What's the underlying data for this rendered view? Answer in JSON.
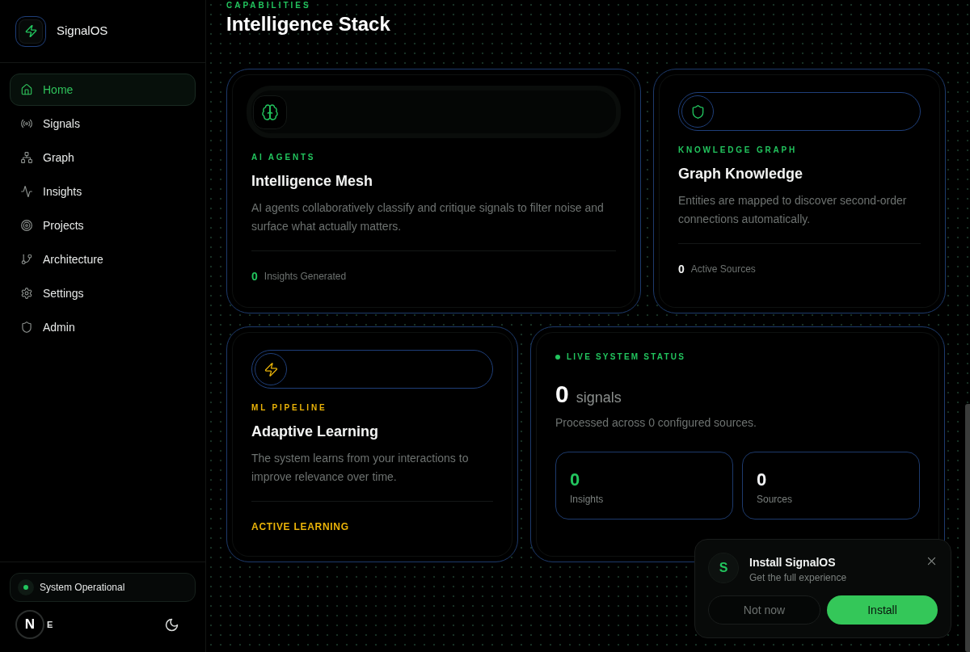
{
  "sidebar": {
    "brand": "SignalOS",
    "nav": [
      {
        "label": "Home",
        "selected": true
      },
      {
        "label": "Signals",
        "selected": false
      },
      {
        "label": "Graph",
        "selected": false
      },
      {
        "label": "Insights",
        "selected": false
      },
      {
        "label": "Projects",
        "selected": false
      },
      {
        "label": "Architecture",
        "selected": false
      },
      {
        "label": "Settings",
        "selected": false
      },
      {
        "label": "Admin",
        "selected": false
      }
    ],
    "status": "System Operational",
    "avatar_letter": "N",
    "user_label": "E"
  },
  "header": {
    "eyebrow": "CAPABILITIES",
    "title": "Intelligence Stack"
  },
  "cards": [
    {
      "kind": "agents",
      "color": "#22c55e",
      "tag": "AI AGENTS",
      "title": "Intelligence Mesh",
      "description": "AI agents collaboratively classify and critique signals to filter noise and surface what actually matters.",
      "stat_value": "0",
      "stat_label": "Insights Generated"
    },
    {
      "kind": "graph",
      "color": "#22c55e",
      "tag": "KNOWLEDGE GRAPH",
      "title": "Graph Knowledge",
      "description": "Entities are mapped to discover second-order connections automatically.",
      "stat_value": "0",
      "stat_label": "Active Sources"
    },
    {
      "kind": "pipeline",
      "color": "#eab308",
      "tag": "ML PIPELINE",
      "title": "Adaptive Learning",
      "description": "The system learns from your interactions to improve relevance over time.",
      "footer": "ACTIVE LEARNING"
    },
    {
      "kind": "status",
      "color": "#22c55e",
      "tag": "LIVE SYSTEM STATUS",
      "count": "0",
      "unit": "signals",
      "description": "Processed across 0 configured sources.",
      "stats": [
        {
          "value": "0",
          "label": "Insights",
          "color": "#22c55e"
        },
        {
          "value": "0",
          "label": "Sources",
          "color": "#f3f4f6"
        }
      ]
    }
  ],
  "install_prompt": {
    "avatar_letter": "S",
    "title": "Install SignalOS",
    "subtitle": "Get the full experience",
    "buttons": [
      {
        "label": "Not now",
        "kind": "secondary"
      },
      {
        "label": "Install",
        "kind": "primary"
      }
    ]
  }
}
